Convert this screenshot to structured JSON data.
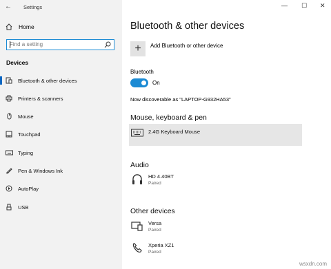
{
  "window": {
    "title": "Settings",
    "back_glyph": "←",
    "minimize": "—",
    "maximize": "☐",
    "close": "✕"
  },
  "sidebar": {
    "home": "Home",
    "search_placeholder": "Find a setting",
    "section": "Devices",
    "items": [
      {
        "label": "Bluetooth & other devices",
        "icon": "bluetooth-devices-icon"
      },
      {
        "label": "Printers & scanners",
        "icon": "printer-icon"
      },
      {
        "label": "Mouse",
        "icon": "mouse-icon"
      },
      {
        "label": "Touchpad",
        "icon": "touchpad-icon"
      },
      {
        "label": "Typing",
        "icon": "keyboard-icon"
      },
      {
        "label": "Pen & Windows Ink",
        "icon": "pen-icon"
      },
      {
        "label": "AutoPlay",
        "icon": "autoplay-icon"
      },
      {
        "label": "USB",
        "icon": "usb-icon"
      }
    ]
  },
  "main": {
    "title": "Bluetooth & other devices",
    "add_label": "Add Bluetooth or other device",
    "bluetooth_label": "Bluetooth",
    "toggle_state": "On",
    "discoverable": "Now discoverable as \"LAPTOP-G932HA53\"",
    "mouse_section": "Mouse, keyboard & pen",
    "mouse_devices": [
      {
        "name": "2.4G Keyboard Mouse",
        "icon": "keyboard-icon"
      }
    ],
    "audio_section": "Audio",
    "audio_devices": [
      {
        "name": "HD 4.40BT",
        "status": "Paired",
        "icon": "headphones-icon"
      }
    ],
    "other_section": "Other devices",
    "other_devices": [
      {
        "name": "Versa",
        "status": "Paired",
        "icon": "device-icon"
      },
      {
        "name": "Xperia XZ1",
        "status": "Paired",
        "icon": "phone-icon"
      }
    ]
  },
  "watermark": "wsxdn.com",
  "colors": {
    "accent": "#1c8bd4",
    "sidebar_bg": "#f2f2f2",
    "selected_row": "#e6e6e6"
  }
}
